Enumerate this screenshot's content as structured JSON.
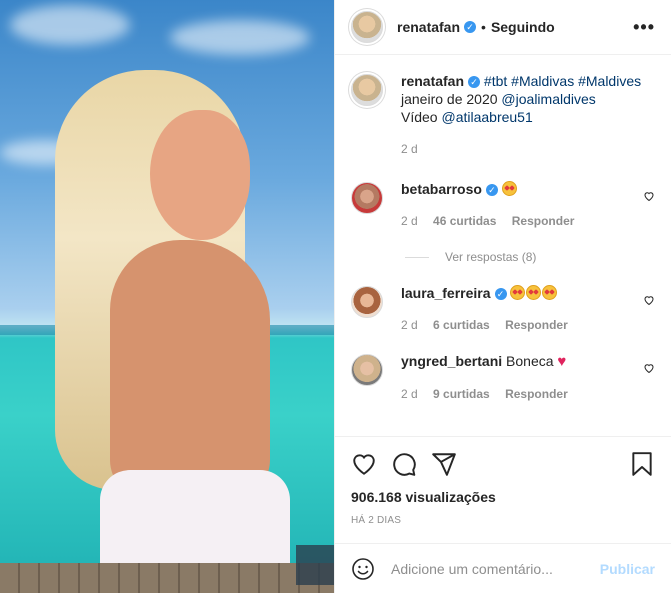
{
  "header": {
    "username": "renatafan",
    "separator": "•",
    "follow_status": "Seguindo",
    "more_glyph": "•••"
  },
  "caption": {
    "username": "renatafan",
    "tags_line": "#tbt #Maldivas #Maldives",
    "line2_text": "janeiro de 2020",
    "line2_mention": "@joalimaldives",
    "line3_text": "Vídeo",
    "line3_mention": "@atilaabreu51",
    "time": "2 d"
  },
  "comments": [
    {
      "username": "betabarroso",
      "verified": true,
      "time": "2 d",
      "likes": "46 curtidas",
      "reply": "Responder"
    },
    {
      "username": "laura_ferreira",
      "verified": true,
      "time": "2 d",
      "likes": "6 curtidas",
      "reply": "Responder"
    },
    {
      "username": "yngred_bertani",
      "verified": false,
      "text": "Boneca",
      "time": "2 d",
      "likes": "9 curtidas",
      "reply": "Responder"
    }
  ],
  "view_replies": "Ver respostas (8)",
  "actions": {
    "views": "906.168 visualizações",
    "time_ago": "HÁ 2 DIAS"
  },
  "add_comment": {
    "placeholder": "Adicione um comentário...",
    "publish": "Publicar"
  },
  "colors": {
    "link": "#00376b",
    "verified": "#3897f0",
    "publish_disabled": "#b3dbff"
  }
}
